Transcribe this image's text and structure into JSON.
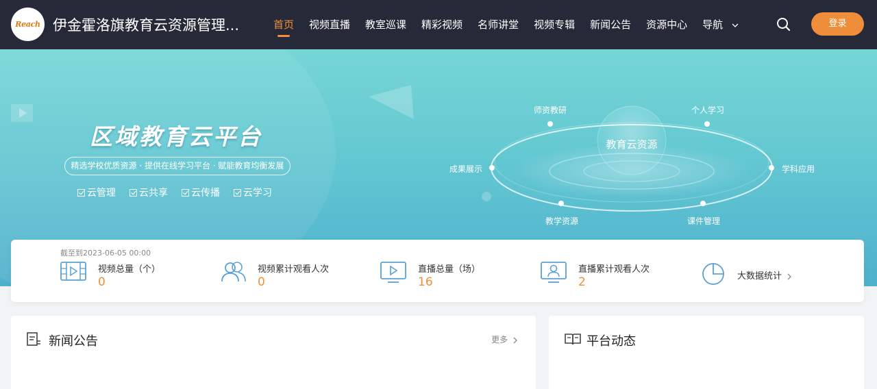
{
  "header": {
    "logo_text": "Reach",
    "site_title": "伊金霍洛旗教育云资源管理...",
    "nav": [
      {
        "label": "首页",
        "active": true
      },
      {
        "label": "视频直播"
      },
      {
        "label": "教室巡课"
      },
      {
        "label": "精彩视频"
      },
      {
        "label": "名师讲堂"
      },
      {
        "label": "视频专辑"
      },
      {
        "label": "新闻公告"
      },
      {
        "label": "资源中心"
      },
      {
        "label": "导航",
        "has_dropdown": true
      }
    ],
    "search_icon": "search-icon",
    "login_label": "登录"
  },
  "banner": {
    "title": "区域教育云平台",
    "subtitle": "精选学校优质资源 · 提供在线学习平台 · 赋能教育均衡发展",
    "tags": [
      "云管理",
      "云共享",
      "云传播",
      "云学习"
    ],
    "center_label": "教育云资源",
    "nodes": [
      "师资教研",
      "个人学习",
      "成果展示",
      "学科应用",
      "教学资源",
      "课件管理"
    ]
  },
  "stats": {
    "as_of": "截至到2023-06-05 00:00",
    "items": [
      {
        "label": "视频总量（个）",
        "value": "0",
        "icon": "video-film-icon"
      },
      {
        "label": "视频累计观看人次",
        "value": "0",
        "icon": "users-icon"
      },
      {
        "label": "直播总量（场）",
        "value": "16",
        "icon": "live-screen-icon"
      },
      {
        "label": "直播累计观看人次",
        "value": "2",
        "icon": "viewer-monitor-icon"
      }
    ],
    "bigdata_label": "大数据统计",
    "bigdata_icon": "pie-chart-icon"
  },
  "panels": {
    "news_title": "新闻公告",
    "news_more": "更多",
    "dynamics_title": "平台动态"
  },
  "colors": {
    "header_bg": "#262a38",
    "accent": "#ee8e3a",
    "banner_top": "#76d6d6",
    "banner_bottom": "#4fb0cc",
    "icon_blue": "#5aa0d8"
  }
}
